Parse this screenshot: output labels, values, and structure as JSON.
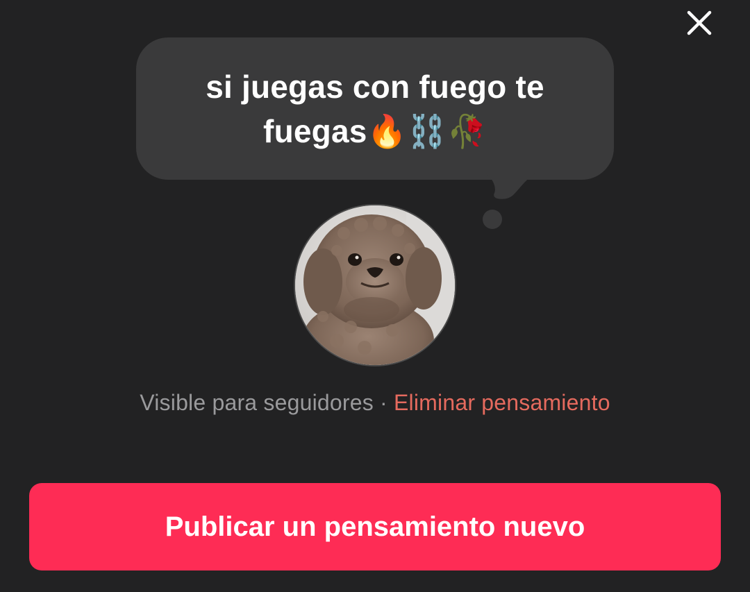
{
  "header": {
    "close_icon": "close-icon"
  },
  "thought": {
    "line1": "si juegas con fuego te",
    "line2": "fuegas🔥⛓️🥀"
  },
  "avatar": {
    "icon": "poodle-avatar"
  },
  "status": {
    "visibility": "Visible para seguidores",
    "separator": " · ",
    "delete_label": "Eliminar pensamiento"
  },
  "actions": {
    "publish_label": "Publicar un pensamiento nuevo"
  },
  "colors": {
    "background": "#222223",
    "bubble": "#3a3a3b",
    "accent": "#fe2c55",
    "delete": "#e56a5e",
    "muted": "#9a9a9c"
  }
}
